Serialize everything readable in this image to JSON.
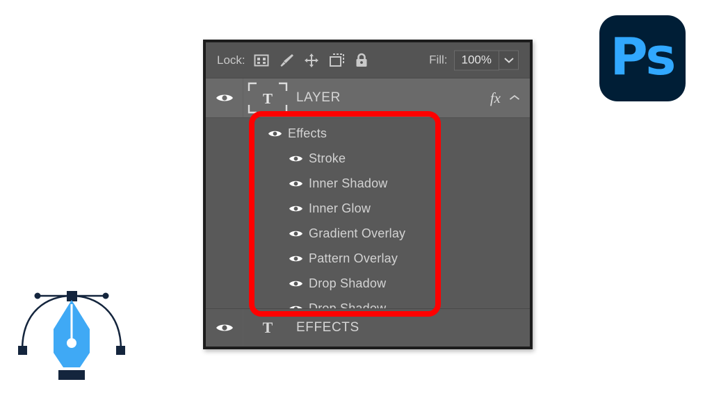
{
  "app": {
    "logo_text": "Ps",
    "logo_bg": "#001e36",
    "logo_fg": "#31a8ff"
  },
  "pen_tool": {
    "name": "pen-tool-illustration",
    "nib_color": "#3fa9f5",
    "path_color": "#14253d"
  },
  "panel": {
    "name": "layers-panel",
    "bg": "#595959",
    "border": "#1c1c1c",
    "lock_row": {
      "label": "Lock:",
      "icons": [
        "transparent-pixels-icon",
        "image-pixels-icon",
        "position-icon",
        "artboard-nesting-icon",
        "lock-all-icon"
      ],
      "fill_label": "Fill:",
      "fill_value": "100%",
      "fill_caret": "chevron-down-icon"
    },
    "selected_layer": {
      "visibility": "eye-icon",
      "thumbnail": "text-layer-thumbnail",
      "thumbnail_glyph": "T",
      "name": "LAYER",
      "fx_badge": "fx",
      "collapse_caret": "chevron-up-icon"
    },
    "effects_group": {
      "header": "Effects",
      "items": [
        "Stroke",
        "Inner Shadow",
        "Inner Glow",
        "Gradient Overlay",
        "Pattern Overlay",
        "Drop Shadow",
        "Drop Shadow"
      ]
    },
    "bottom_layer": {
      "visibility": "eye-icon",
      "thumbnail_glyph": "T",
      "name": "EFFECTS"
    }
  },
  "annotation": {
    "name": "red-highlight-box",
    "color": "#ff0000"
  }
}
